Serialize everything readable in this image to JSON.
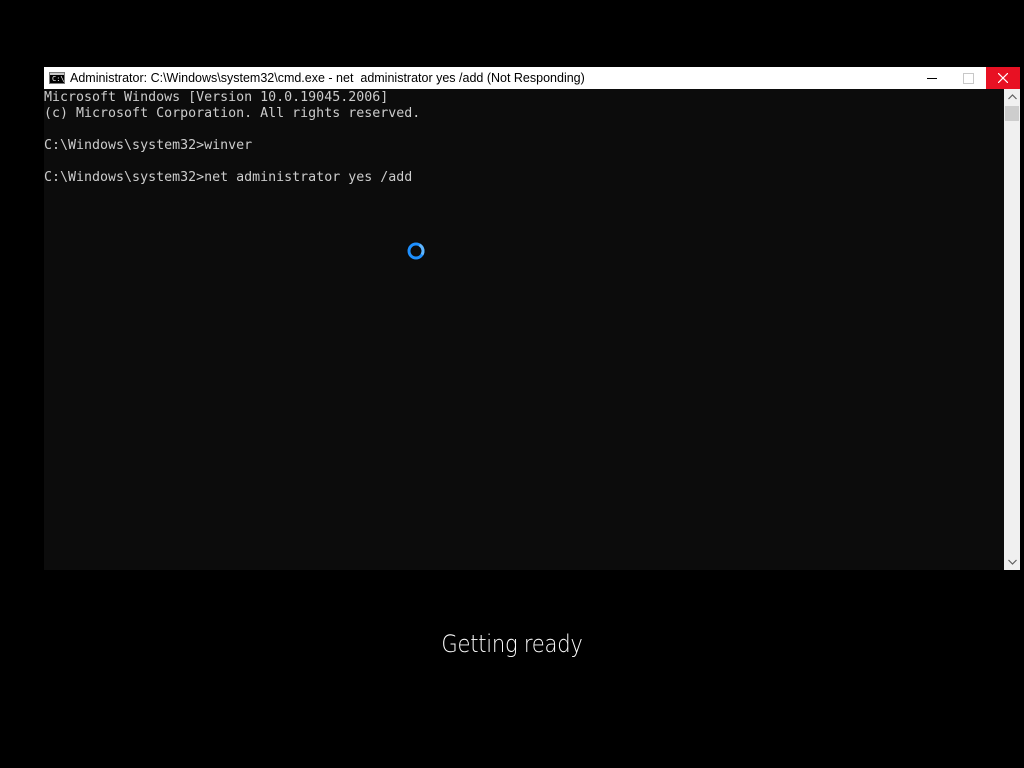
{
  "window": {
    "title": "Administrator: C:\\Windows\\system32\\cmd.exe - net  administrator yes /add (Not Responding)",
    "icon": "cmd-icon",
    "controls": {
      "minimize": "minimize-icon",
      "maximize": "maximize-icon",
      "close": "close-icon"
    },
    "close_color": "#e81123"
  },
  "console": {
    "lines": [
      "Microsoft Windows [Version 10.0.19045.2006]",
      "(c) Microsoft Corporation. All rights reserved.",
      "",
      "C:\\Windows\\system32>winver",
      "",
      "C:\\Windows\\system32>net administrator yes /add"
    ],
    "text_color": "#cccccc",
    "background": "#0c0c0c"
  },
  "busy_cursor": {
    "icon": "loading-spinner-icon",
    "color": "#1e90ff"
  },
  "status": {
    "text": "Getting ready"
  }
}
